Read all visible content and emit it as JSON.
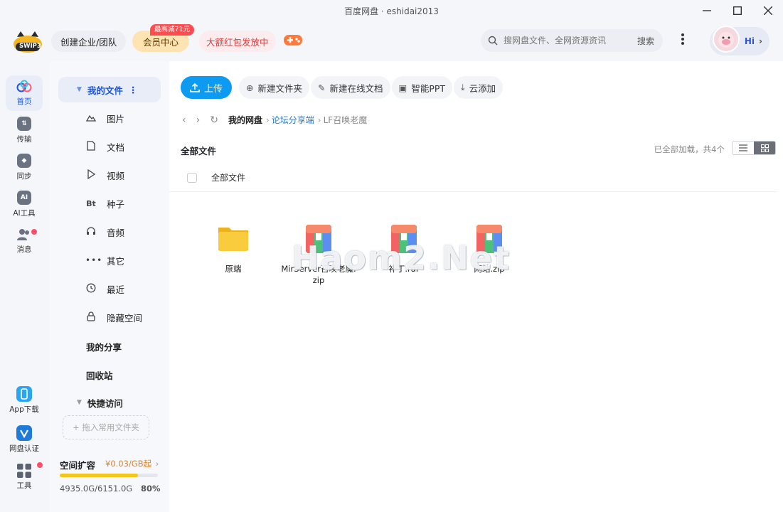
{
  "window": {
    "title": "百度网盘 · eshidai2013"
  },
  "topbar": {
    "logo_text": "SWIP3",
    "team_label": "创建企业/团队",
    "vip_label": "会员中心",
    "vip_badge": "最高减71元",
    "redpack_label": "大额红包发放中",
    "search_placeholder": "搜网盘文件、全网资源资讯",
    "search_button": "搜索",
    "user_greeting": "Hi"
  },
  "rail": {
    "items": [
      {
        "label": "首页",
        "icon": "cloud-icon"
      },
      {
        "label": "传输",
        "icon": "transfer-icon"
      },
      {
        "label": "同步",
        "icon": "sync-icon"
      },
      {
        "label": "AI工具",
        "icon": "ai-icon"
      },
      {
        "label": "消息",
        "icon": "message-icon"
      }
    ],
    "bottom": [
      {
        "label": "App下载",
        "icon": "phone-icon"
      },
      {
        "label": "网盘认证",
        "icon": "verify-icon"
      },
      {
        "label": "工具",
        "icon": "apps-icon"
      }
    ]
  },
  "nav": {
    "my_files": "我的文件",
    "items": [
      {
        "label": "图片",
        "icon": "image-icon"
      },
      {
        "label": "文档",
        "icon": "document-icon"
      },
      {
        "label": "视频",
        "icon": "video-icon"
      },
      {
        "label": "种子",
        "icon": "torrent-icon",
        "glyph": "Bt"
      },
      {
        "label": "音频",
        "icon": "headphones-icon"
      },
      {
        "label": "其它",
        "icon": "more-icon"
      },
      {
        "label": "最近",
        "icon": "clock-icon"
      },
      {
        "label": "隐藏空间",
        "icon": "lock-icon"
      }
    ],
    "my_share": "我的分享",
    "recycle": "回收站",
    "quick_access": "快捷访问",
    "quick_add": "+ 拖入常用文件夹",
    "storage": {
      "title": "空间扩容",
      "price": "¥0.03/GB起",
      "used_text": "4935.0G/6151.0G",
      "percent_text": "80%",
      "percent": 80
    }
  },
  "toolbar": {
    "upload": "上传",
    "new_folder": "新建文件夹",
    "new_doc": "新建在线文档",
    "smart_ppt": "智能PPT",
    "cloud_add": "云添加"
  },
  "breadcrumb": [
    "我的网盘",
    "论坛分享端",
    "LF召唤老魔"
  ],
  "listing": {
    "title": "全部文件",
    "loaded_info": "已全部加载，共4个",
    "header_label": "全部文件"
  },
  "files": [
    {
      "name": "原端",
      "type": "folder"
    },
    {
      "name": "MirServer召唤老魔.zip",
      "type": "archive"
    },
    {
      "name": "补丁.rar",
      "type": "archive"
    },
    {
      "name": "网站.zip",
      "type": "archive"
    }
  ],
  "watermark": "Haom2.Net",
  "colors": {
    "accent": "#0d9bf2",
    "folder": "#f7c12e",
    "vip": "#ffe3b3",
    "danger": "#ff4d4f"
  }
}
